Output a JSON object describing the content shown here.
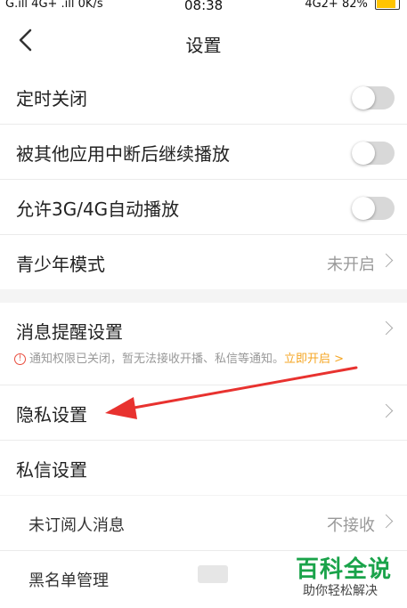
{
  "status_bar": {
    "left": "G.ıll 4G+ .ıll 0K/s",
    "time": "08:38",
    "right": "4G2+ 82%"
  },
  "header": {
    "title": "设置"
  },
  "playback": [
    {
      "label": "定时关闭"
    },
    {
      "label": "被其他应用中断后继续播放"
    },
    {
      "label": "允许3G/4G自动播放"
    },
    {
      "label": "青少年模式",
      "value": "未开启"
    }
  ],
  "notifications": {
    "label": "消息提醒设置",
    "notice": "通知权限已关闭，暂无法接收开播、私信等通知。",
    "notice_link": "立即开启 >"
  },
  "privacy": {
    "label": "隐私设置"
  },
  "messages": {
    "label": "私信设置",
    "items": [
      {
        "label": "未订阅人消息",
        "value": "不接收"
      },
      {
        "label": "黑名单管理"
      }
    ]
  },
  "watermark": {
    "title": "百科全说",
    "subtitle": "助你轻松解决"
  },
  "colors": {
    "accent": "#f5a623",
    "warning": "#e94b3c",
    "annotation_arrow": "#e8322f"
  }
}
